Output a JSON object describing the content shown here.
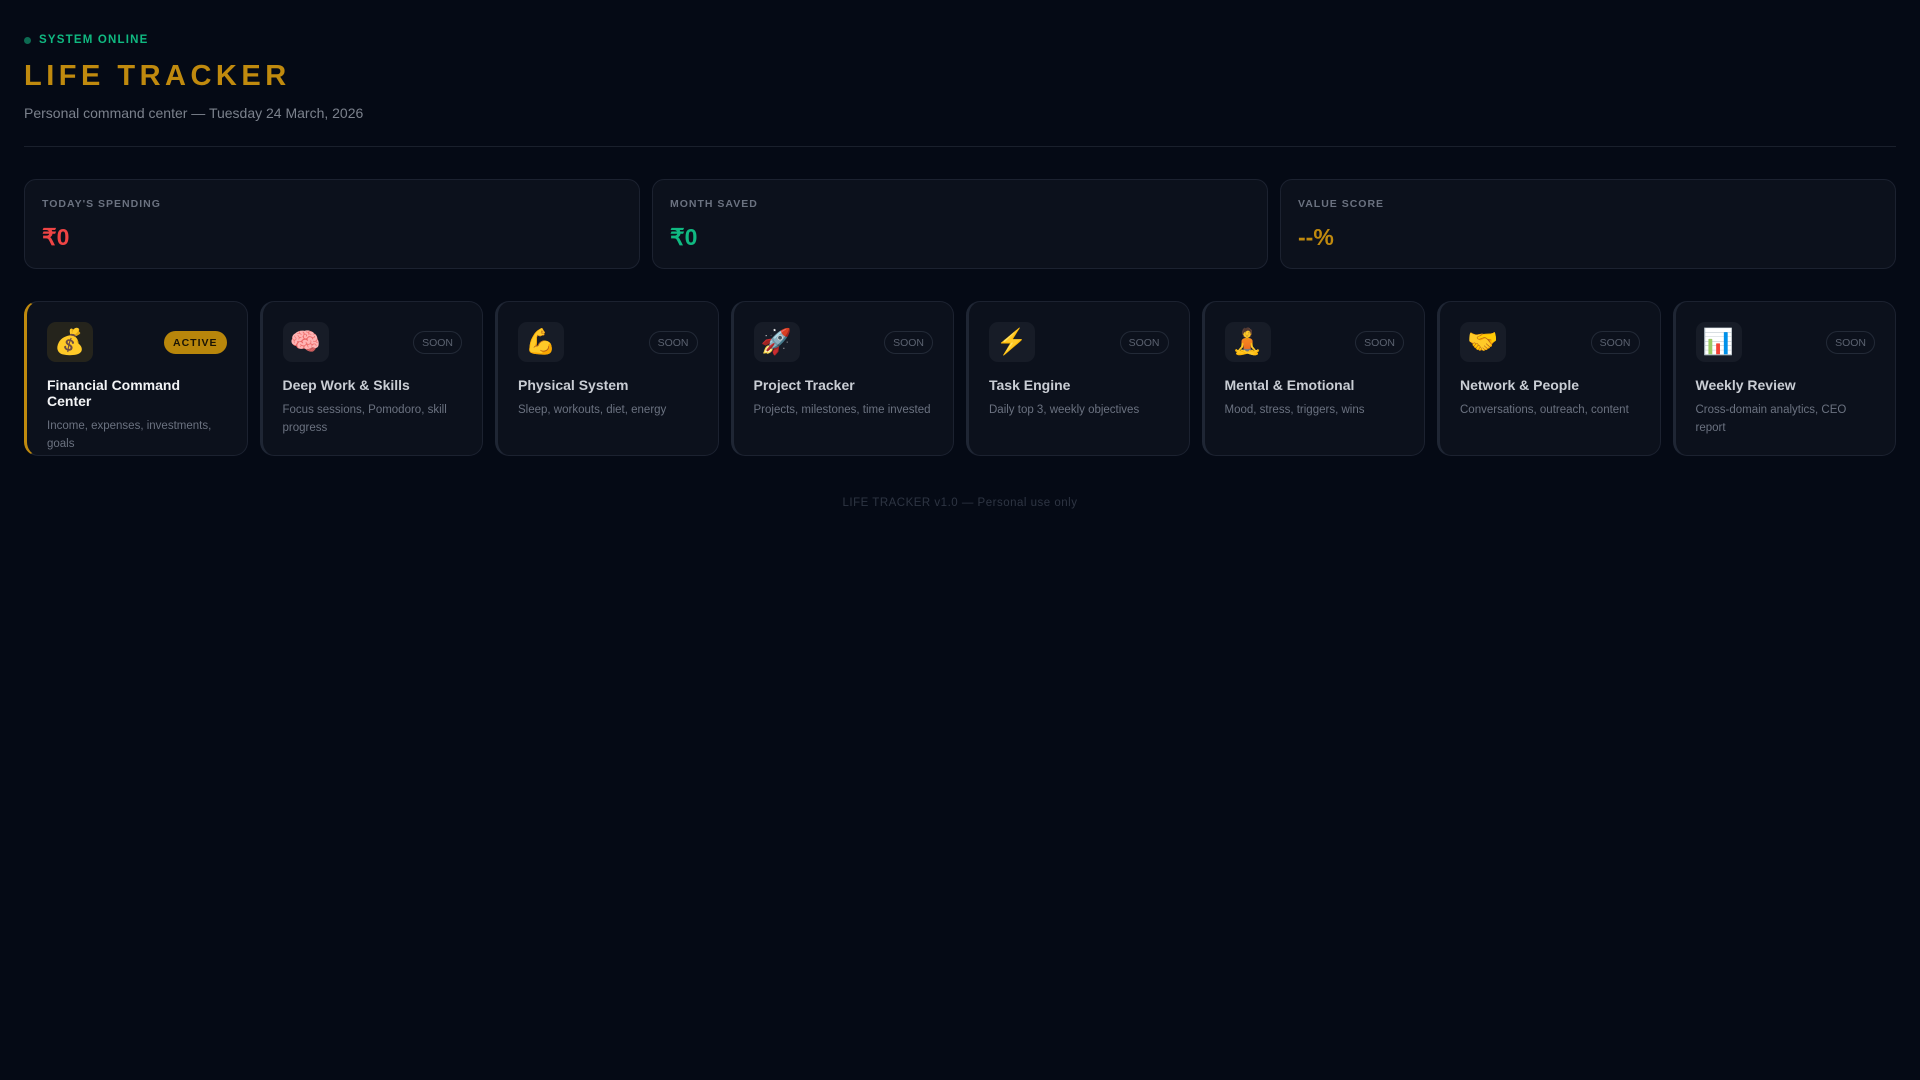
{
  "header": {
    "status": "SYSTEM ONLINE",
    "title": "LIFE TRACKER",
    "subtitle": "Personal command center — Tuesday 24 March, 2026"
  },
  "stats": [
    {
      "label": "TODAY'S SPENDING",
      "value": "₹0",
      "color": "#ef4444"
    },
    {
      "label": "MONTH SAVED",
      "value": "₹0",
      "color": "#10b981"
    },
    {
      "label": "VALUE SCORE",
      "value": "--%",
      "color": "#c08a0e"
    }
  ],
  "modules": [
    {
      "icon": "💰",
      "icon_name": "money-bag-icon",
      "badge": "ACTIVE",
      "title": "Financial Command Center",
      "desc": "Income, expenses, investments, goals",
      "active": true
    },
    {
      "icon": "🧠",
      "icon_name": "brain-icon",
      "badge": "SOON",
      "title": "Deep Work & Skills",
      "desc": "Focus sessions, Pomodoro, skill progress"
    },
    {
      "icon": "💪",
      "icon_name": "flexed-biceps-icon",
      "badge": "SOON",
      "title": "Physical System",
      "desc": "Sleep, workouts, diet, energy"
    },
    {
      "icon": "🚀",
      "icon_name": "rocket-icon",
      "badge": "SOON",
      "title": "Project Tracker",
      "desc": "Projects, milestones, time invested"
    },
    {
      "icon": "⚡",
      "icon_name": "lightning-icon",
      "badge": "SOON",
      "title": "Task Engine",
      "desc": "Daily top 3, weekly objectives"
    },
    {
      "icon": "🧘",
      "icon_name": "meditation-icon",
      "badge": "SOON",
      "title": "Mental & Emotional",
      "desc": "Mood, stress, triggers, wins"
    },
    {
      "icon": "🤝",
      "icon_name": "handshake-icon",
      "badge": "SOON",
      "title": "Network & People",
      "desc": "Conversations, outreach, content"
    },
    {
      "icon": "📊",
      "icon_name": "bar-chart-icon",
      "badge": "SOON",
      "title": "Weekly Review",
      "desc": "Cross-domain analytics, CEO report"
    }
  ],
  "footer": "LIFE TRACKER v1.0 — Personal use only"
}
